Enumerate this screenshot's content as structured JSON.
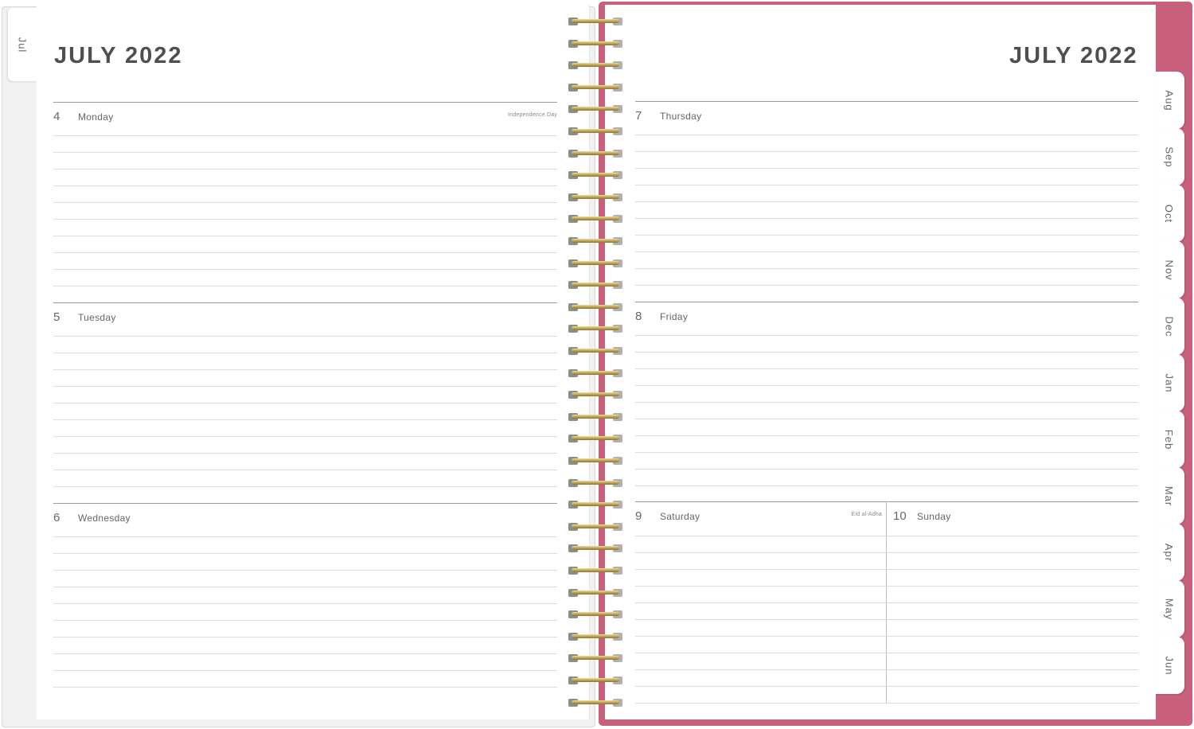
{
  "left_tab": "Jul",
  "left_title": "JULY 2022",
  "right_title": "JULY 2022",
  "month_tabs": [
    "Aug",
    "Sep",
    "Oct",
    "Nov",
    "Dec",
    "Jan",
    "Feb",
    "Mar",
    "Apr",
    "May",
    "Jun"
  ],
  "left_days": [
    {
      "num": "4",
      "name": "Monday",
      "holiday": "Independence Day"
    },
    {
      "num": "5",
      "name": "Tuesday",
      "holiday": ""
    },
    {
      "num": "6",
      "name": "Wednesday",
      "holiday": ""
    }
  ],
  "right_days": [
    {
      "num": "7",
      "name": "Thursday",
      "holiday": ""
    },
    {
      "num": "8",
      "name": "Friday",
      "holiday": ""
    }
  ],
  "weekend": {
    "saturday": {
      "num": "9",
      "name": "Saturday",
      "holiday": "Eid al-Adha"
    },
    "sunday": {
      "num": "10",
      "name": "Sunday",
      "holiday": ""
    }
  },
  "colors": {
    "cover": "#c8607c",
    "wire": "#b89a4a"
  }
}
